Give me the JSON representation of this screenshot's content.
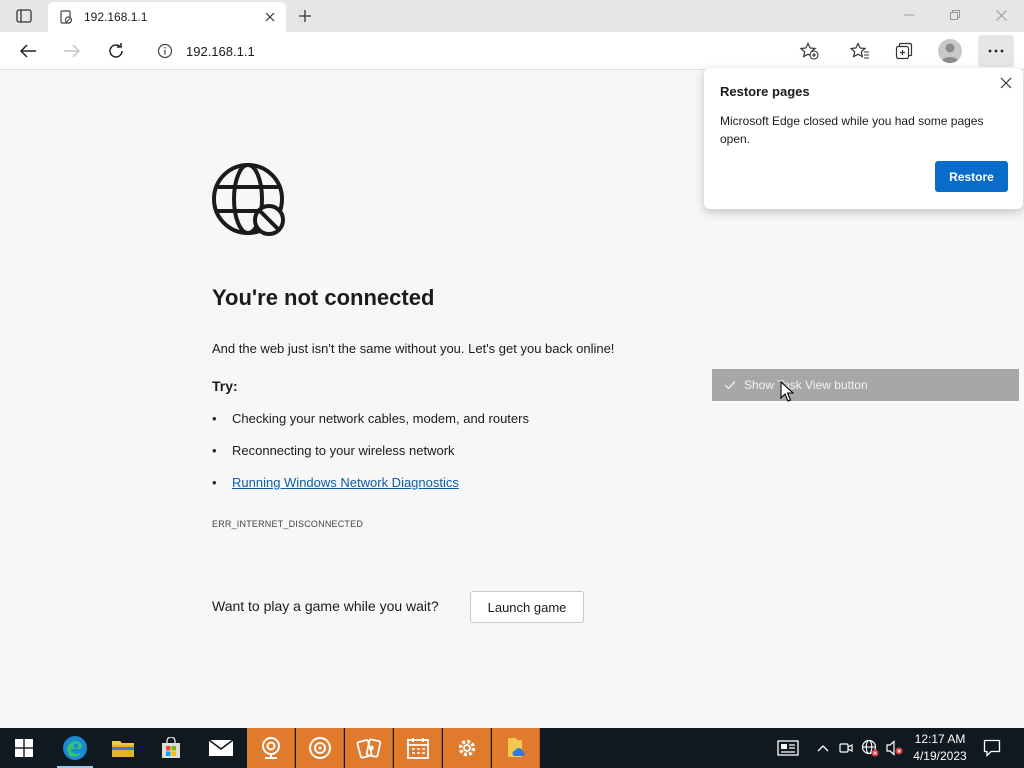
{
  "browser": {
    "tab": {
      "title": "192.168.1.1"
    },
    "address_bar": {
      "url": "192.168.1.1"
    }
  },
  "page": {
    "heading": "You're not connected",
    "description": "And the web just isn't the same without you. Let's get you back online!",
    "try_label": "Try:",
    "tips": [
      "Checking your network cables, modem, and routers",
      "Reconnecting to your wireless network",
      "Running Windows Network Diagnostics"
    ],
    "bullet": "•",
    "error_code": "ERR_INTERNET_DISCONNECTED",
    "game_prompt": "Want to play a game while you wait?",
    "launch_game_label": "Launch game"
  },
  "restore_popup": {
    "title": "Restore pages",
    "message": "Microsoft Edge closed while you had some pages open.",
    "restore_label": "Restore"
  },
  "tooltip": {
    "label": "Show Task View button"
  },
  "taskbar": {
    "apps": [
      "windows-start",
      "edge",
      "file-explorer",
      "microsoft-store",
      "mail",
      "webcam",
      "groove",
      "solitaire",
      "calendar",
      "settings",
      "onedrive-folder"
    ],
    "clock": {
      "time": "12:17 AM",
      "date": "4/19/2023"
    }
  },
  "colors": {
    "accent": "#0a6cc9",
    "link": "#0b5ea8",
    "taskbar": "#101820",
    "taskbar_highlight": "#e07a2c"
  }
}
